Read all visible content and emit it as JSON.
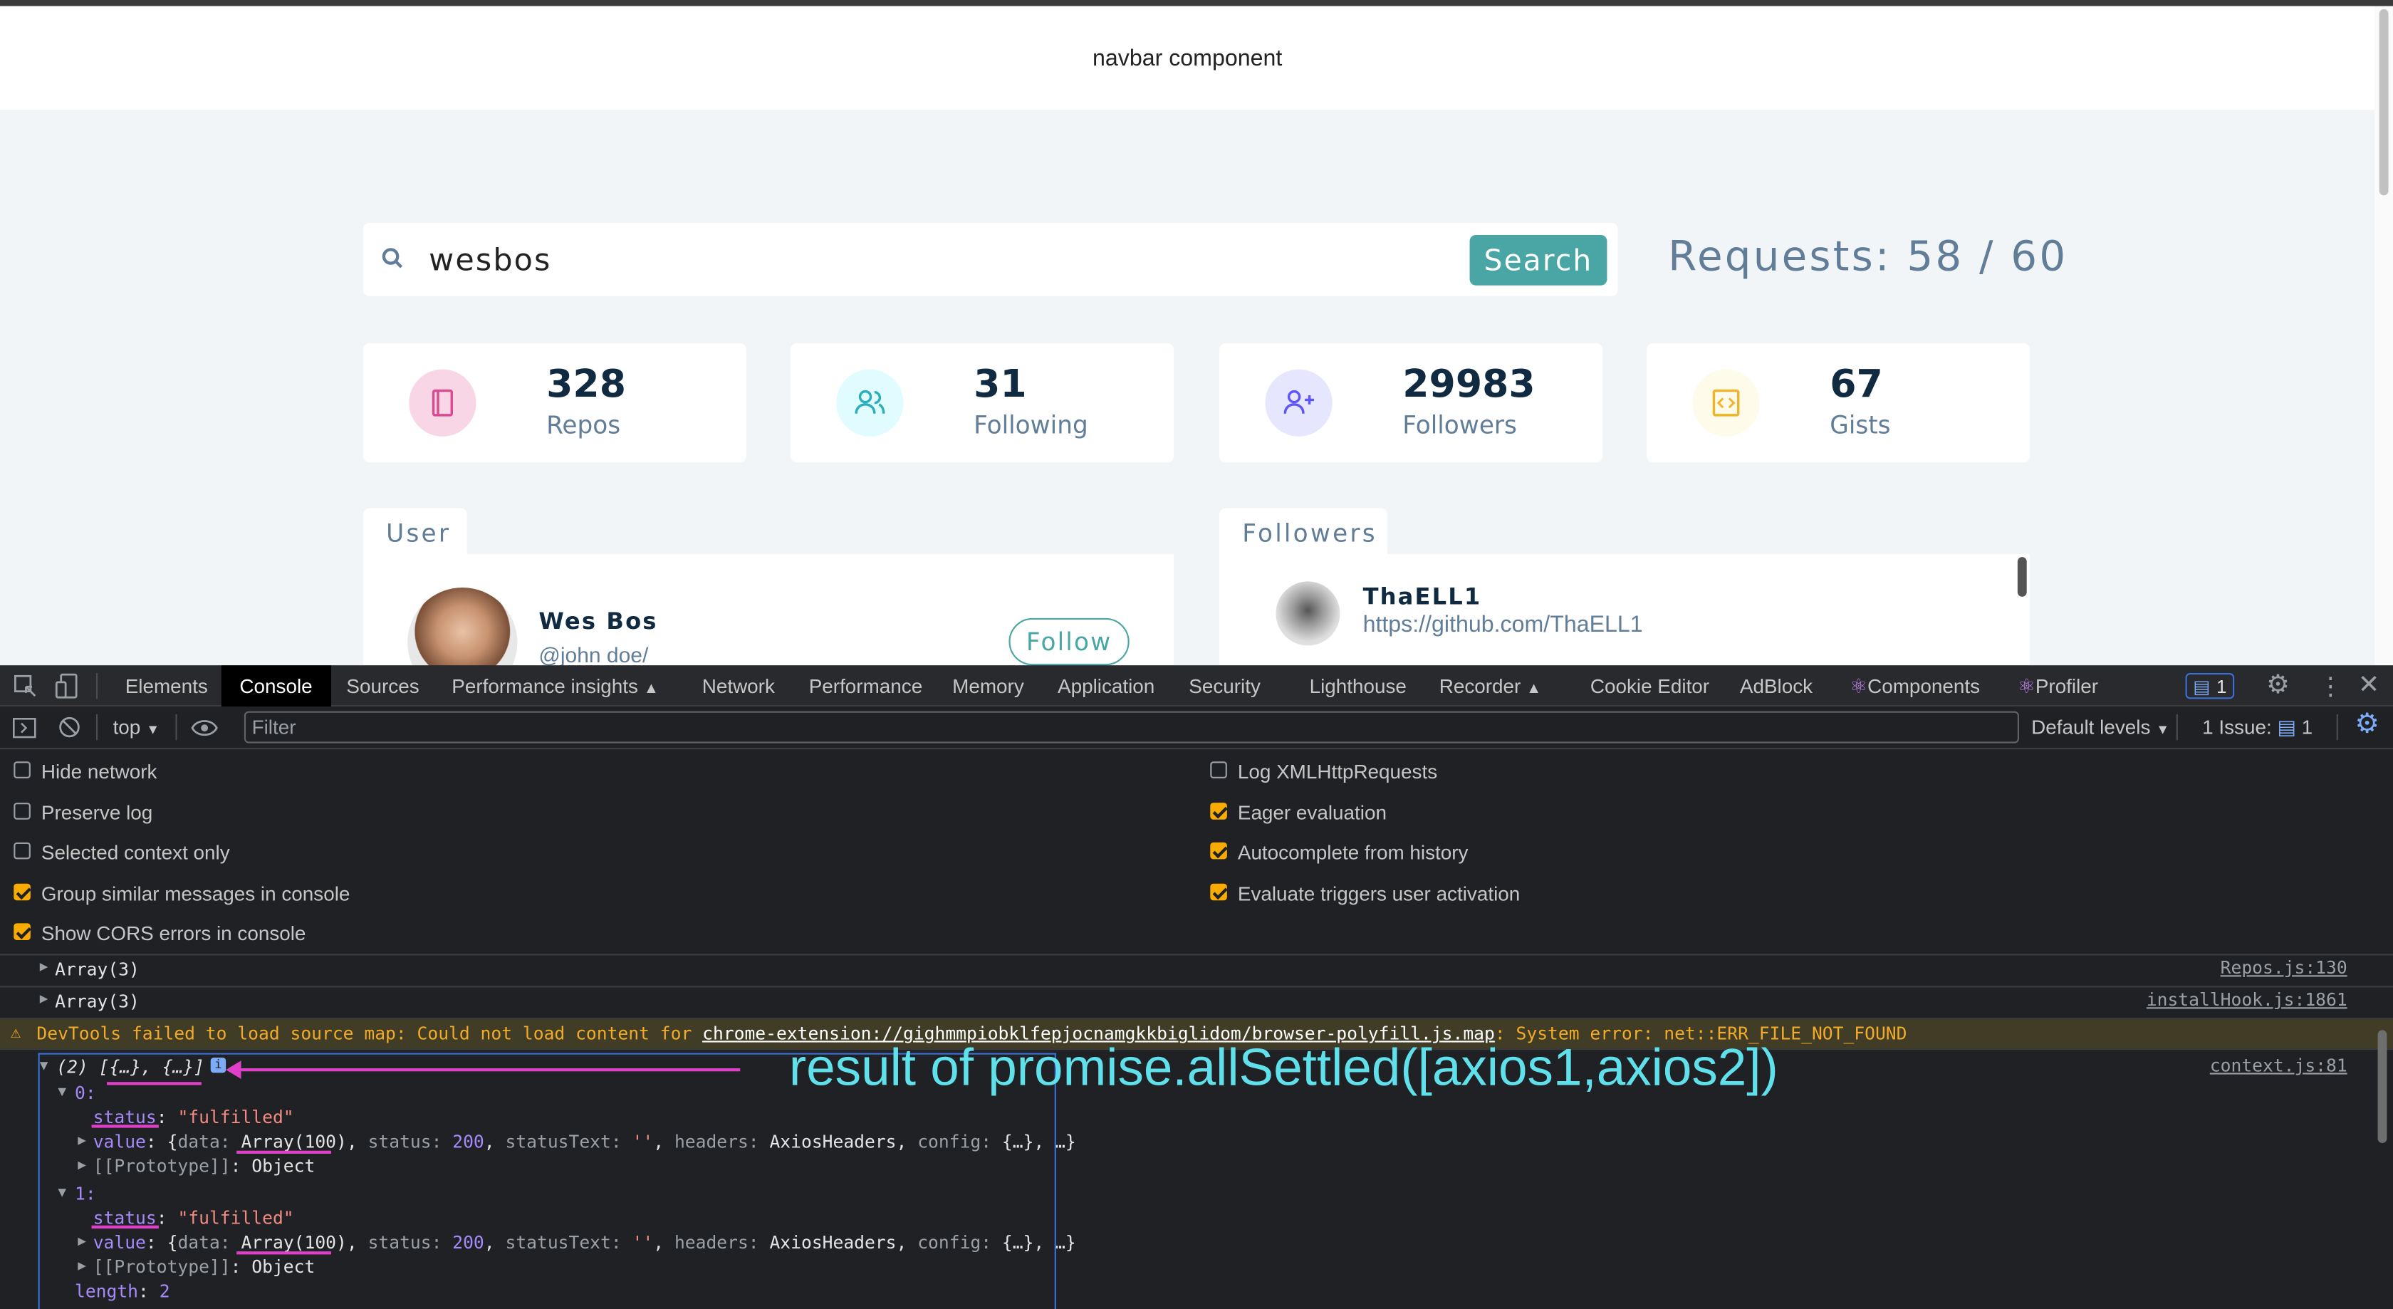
{
  "navbar": {
    "title": "navbar component"
  },
  "search": {
    "value": "wesbos",
    "button": "Search"
  },
  "requests": "Requests: 58 / 60",
  "stats": [
    {
      "value": "328",
      "label": "Repos",
      "icon": "repo-book-icon",
      "color": "#f9d6e5"
    },
    {
      "value": "31",
      "label": "Following",
      "icon": "users-icon",
      "color": "#e0fcff"
    },
    {
      "value": "29983",
      "label": "Followers",
      "icon": "user-plus-icon",
      "color": "#e6e6ff"
    },
    {
      "value": "67",
      "label": "Gists",
      "icon": "code-icon",
      "color": "#fffbea"
    }
  ],
  "user_panel": {
    "tab": "User",
    "name": "Wes Bos",
    "handle": "@john doe/",
    "follow": "Follow"
  },
  "followers_panel": {
    "tab": "Followers",
    "follower_name": "ThaELL1",
    "follower_url": "https://github.com/ThaELL1"
  },
  "devtools": {
    "tabs": [
      "Elements",
      "Console",
      "Sources",
      "Performance insights",
      "Network",
      "Performance",
      "Memory",
      "Application",
      "Security",
      "Lighthouse",
      "Recorder",
      "Cookie Editor",
      "AdBlock",
      "Components",
      "Profiler"
    ],
    "active_tab": "Console",
    "messages_badge": "1",
    "context": "top",
    "filter_placeholder": "Filter",
    "levels": "Default levels",
    "issues": "1 Issue:",
    "issues_count": "1",
    "settings_left": [
      {
        "label": "Hide network",
        "checked": false
      },
      {
        "label": "Preserve log",
        "checked": false
      },
      {
        "label": "Selected context only",
        "checked": false
      },
      {
        "label": "Group similar messages in console",
        "checked": true
      },
      {
        "label": "Show CORS errors in console",
        "checked": true
      }
    ],
    "settings_right": [
      {
        "label": "Log XMLHttpRequests",
        "checked": false
      },
      {
        "label": "Eager evaluation",
        "checked": true
      },
      {
        "label": "Autocomplete from history",
        "checked": true
      },
      {
        "label": "Evaluate triggers user activation",
        "checked": true
      }
    ],
    "log": {
      "array1": "Array(3)",
      "array1_src": "Repos.js:130",
      "array2": "Array(3)",
      "array2_src": "installHook.js:1861",
      "warning_prefix": "DevTools failed to load source map: Could not load content for ",
      "warning_link": "chrome-extension://gighmmpiobklfepjocnamgkkbiglidom/browser-polyfill.js.map",
      "warning_suffix": ": System error: net::ERR_FILE_NOT_FOUND",
      "result_summary": "(2) [{…}, {…}]",
      "result_src": "context.js:81",
      "item0": "0:",
      "item1": "1:",
      "status_key": "status",
      "status_val": "\"fulfilled\"",
      "value_key": "value",
      "proto": "[[Prototype]]",
      "proto_val": "Object",
      "length_key": "length",
      "length_val": "2"
    }
  },
  "annotation": "result of promise.allSettled([axios1,axios2])"
}
